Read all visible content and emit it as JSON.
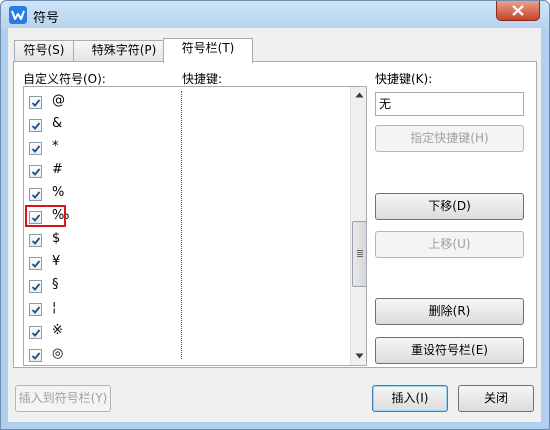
{
  "window": {
    "title": "符号"
  },
  "tabs": [
    {
      "label": "符号(S)"
    },
    {
      "label": "特殊字符(P)"
    },
    {
      "label": "符号栏(T)"
    }
  ],
  "list": {
    "header_symbol": "自定义符号(O):",
    "header_shortcut": "快捷键:",
    "items": [
      {
        "symbol": "@",
        "checked": true
      },
      {
        "symbol": "&",
        "checked": true
      },
      {
        "symbol": "*",
        "checked": true
      },
      {
        "symbol": "#",
        "checked": true
      },
      {
        "symbol": "%",
        "checked": true
      },
      {
        "symbol": "‰",
        "checked": true
      },
      {
        "symbol": "$",
        "checked": true
      },
      {
        "symbol": "¥",
        "checked": true
      },
      {
        "symbol": "§",
        "checked": true
      },
      {
        "symbol": "¦",
        "checked": true
      },
      {
        "symbol": "※",
        "checked": true
      },
      {
        "symbol": "◎",
        "checked": true
      }
    ]
  },
  "shortcut": {
    "label": "快捷键(K):",
    "value": "无",
    "assign_button": "指定快捷键(H)"
  },
  "buttons": {
    "move_down": "下移(D)",
    "move_up": "上移(U)",
    "delete": "删除(R)",
    "reset": "重设符号栏(E)",
    "insert_to_bar": "插入到符号栏(Y)",
    "insert": "插入(I)",
    "close": "关闭"
  },
  "colors": {
    "highlight": "#d9151a",
    "check": "#1f4f88",
    "accent": "#2b7be3"
  },
  "icons": {
    "app": "wps-w-icon",
    "close": "close-x-icon",
    "scroll_up": "triangle-up-icon",
    "scroll_down": "triangle-down-icon"
  }
}
